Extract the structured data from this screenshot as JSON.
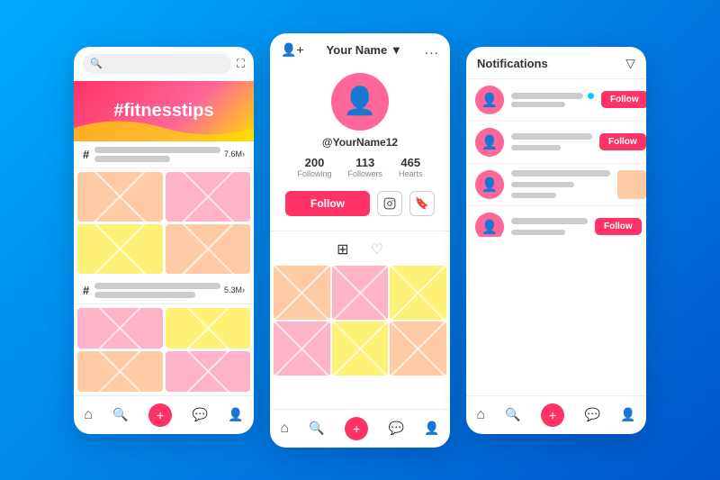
{
  "phone1": {
    "search_placeholder": "Search",
    "hero_text": "#fitnesstips",
    "section1_hash": "#",
    "section1_count": "7.6M›",
    "section2_hash": "#",
    "section2_count": "5.3M›",
    "nav": {
      "home": "⌂",
      "search": "🔍",
      "add": "+",
      "chat": "💬",
      "profile": "👤"
    }
  },
  "phone2": {
    "header_title": "Your Name ▼",
    "header_dots": "...",
    "username": "@YourName12",
    "following": "200",
    "following_label": "Following",
    "followers": "113",
    "followers_label": "Followers",
    "hearts": "465",
    "hearts_label": "Hearts",
    "follow_btn": "Follow",
    "nav": {
      "home": "⌂",
      "search": "🔍",
      "add": "+",
      "chat": "💬",
      "profile": "👤"
    }
  },
  "phone3": {
    "header_title": "Notifications",
    "filter_icon": "▽",
    "notifications": [
      {
        "has_dot": true,
        "has_follow": true,
        "has_thumb": false
      },
      {
        "has_dot": false,
        "has_follow": true,
        "has_thumb": false
      },
      {
        "has_dot": false,
        "has_follow": false,
        "has_thumb": true,
        "thumb_color": "peach"
      },
      {
        "has_dot": false,
        "has_follow": true,
        "has_thumb": false
      },
      {
        "has_dot": false,
        "has_follow": true,
        "has_thumb": false
      },
      {
        "has_dot": false,
        "has_follow": false,
        "has_thumb": false
      }
    ],
    "follow_label": "Follow",
    "nav": {
      "home": "⌂",
      "search": "🔍",
      "add": "+",
      "chat": "💬",
      "profile": "👤"
    }
  }
}
